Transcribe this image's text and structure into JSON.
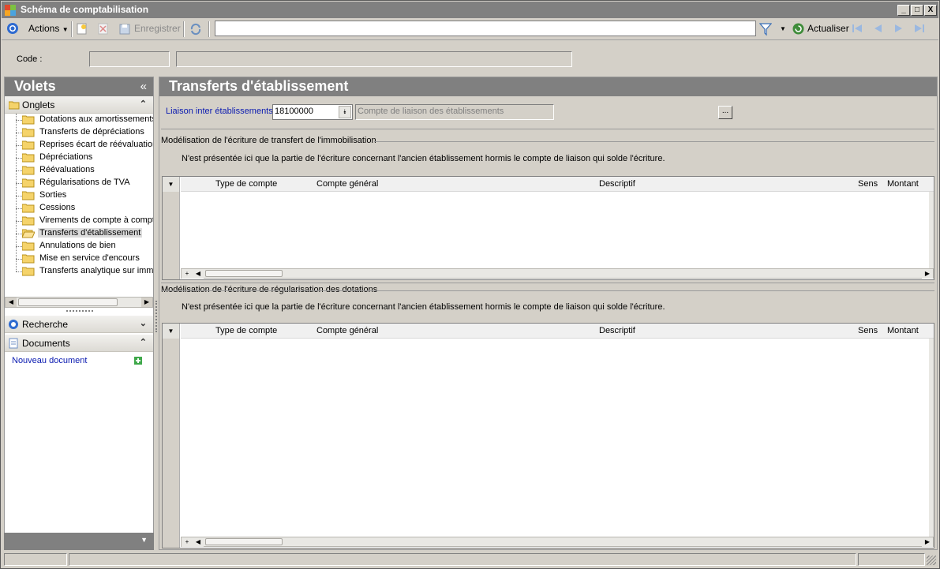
{
  "window": {
    "title": "Schéma de comptabilisation",
    "controls": {
      "minimize": "_",
      "maximize": "□",
      "close": "X"
    }
  },
  "toolbar": {
    "actions_label": "Actions",
    "save_label": "Enregistrer",
    "search_value": "",
    "refresh_label": "Actualiser"
  },
  "code_row": {
    "code_label": "Code :"
  },
  "left_pane": {
    "header": "Volets",
    "collapse_glyph": "«",
    "onglets_label": "Onglets",
    "tree_items": [
      "Dotations aux amortissements",
      "Transferts de dépréciations",
      "Reprises écart de réévaluation",
      "Dépréciations",
      "Réévaluations",
      "Régularisations de TVA",
      "Sorties",
      "Cessions",
      "Virements de compte à compte",
      "Transferts d'établissement",
      "Annulations de bien",
      "Mise en service d'encours",
      "Transferts analytique sur immo"
    ],
    "selected_index": 9,
    "recherche_label": "Recherche",
    "documents_label": "Documents",
    "new_document_label": "Nouveau document"
  },
  "main": {
    "title": "Transferts d'établissement",
    "liaison_label": "Liaison inter établissements:",
    "liaison_value": "18100000",
    "liaison_desc": "Compte de liaison des établissements",
    "ellipsis": "...",
    "section1": {
      "title": "Modélisation de l'écriture de transfert de l'immobilisation",
      "note": "N'est présentée ici que la partie de l'écriture concernant l'ancien établissement hormis le compte de liaison qui solde l'écriture."
    },
    "section2": {
      "title": "Modélisation de l'écriture de régularisation des dotations",
      "note": "N'est présentée ici que la partie de l'écriture concernant l'ancien établissement hormis le compte de liaison qui solde l'écriture."
    },
    "grid_columns": [
      "Type de compte",
      "Compte général",
      "Descriptif",
      "Sens",
      "Montant"
    ],
    "grid_add": "+"
  },
  "colors": {
    "titlebar": "#808080",
    "panel": "#d4d0c8",
    "link": "#0a1ab0",
    "folder": "#f5d36a"
  }
}
